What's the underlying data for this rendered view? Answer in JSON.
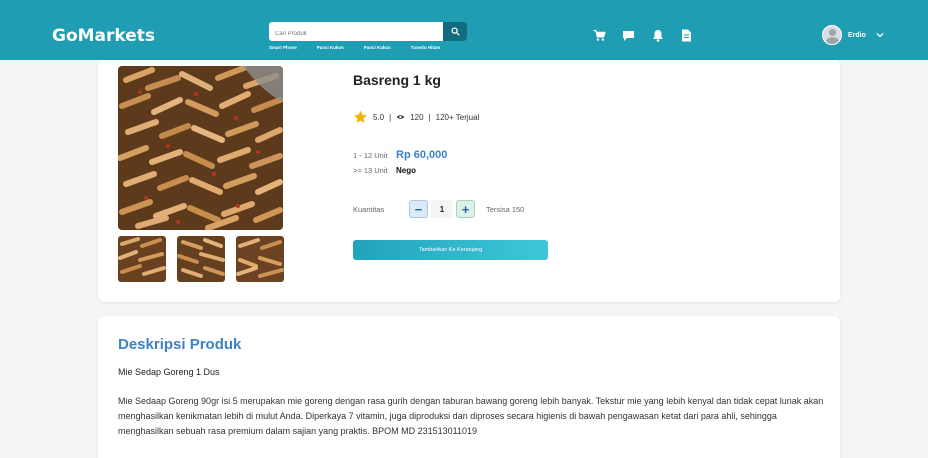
{
  "header": {
    "brand": "GoMarkets",
    "search_placeholder": "Cari Produk",
    "quick_links": [
      "Smart Phone",
      "Panci Kukus",
      "Panci Kukus",
      "Tuxedo Hitam"
    ],
    "icons": [
      "cart-icon",
      "chat-icon",
      "bell-icon",
      "document-icon"
    ],
    "user_name": "Erdio"
  },
  "product": {
    "title": "Basreng 1 kg",
    "rating": "5.0",
    "views": "120",
    "sold": "120+ Terjual",
    "price_tiers": [
      {
        "label": "1 - 12 Unit",
        "value": "Rp 60,000"
      },
      {
        "label": ">= 13 Unit",
        "value": "Nego"
      }
    ],
    "quantity_label": "Kuantitas",
    "quantity_value": "1",
    "minus": "−",
    "plus": "+",
    "stock": "Tersisa 150",
    "add_to_cart": "Tambahkan Ke Keranjang"
  },
  "description": {
    "title": "Deskripsi Produk",
    "subtitle": "Mie Sedap Goreng 1 Dus",
    "body": "Mie Sedaap Goreng 90gr isi 5 merupakan mie goreng dengan rasa gurih dengan taburan bawang goreng lebih banyak. Tekstur mie yang lebih kenyal dan tidak cepat lunak akan menghasilkan kenikmatan lebih di mulut Anda. Diperkaya 7 vitamin, juga diproduksi dan diproses secara higienis di bawah pengawasan ketat dari para ahli, sehingga menghasilkan sebuah rasa premium dalam sajian yang praktis. BPOM MD 231513011019"
  },
  "colors": {
    "header": "#1e9db3",
    "accent_blue": "#3d82c4",
    "button_start": "#22a3bd",
    "button_end": "#3ec7d8"
  }
}
